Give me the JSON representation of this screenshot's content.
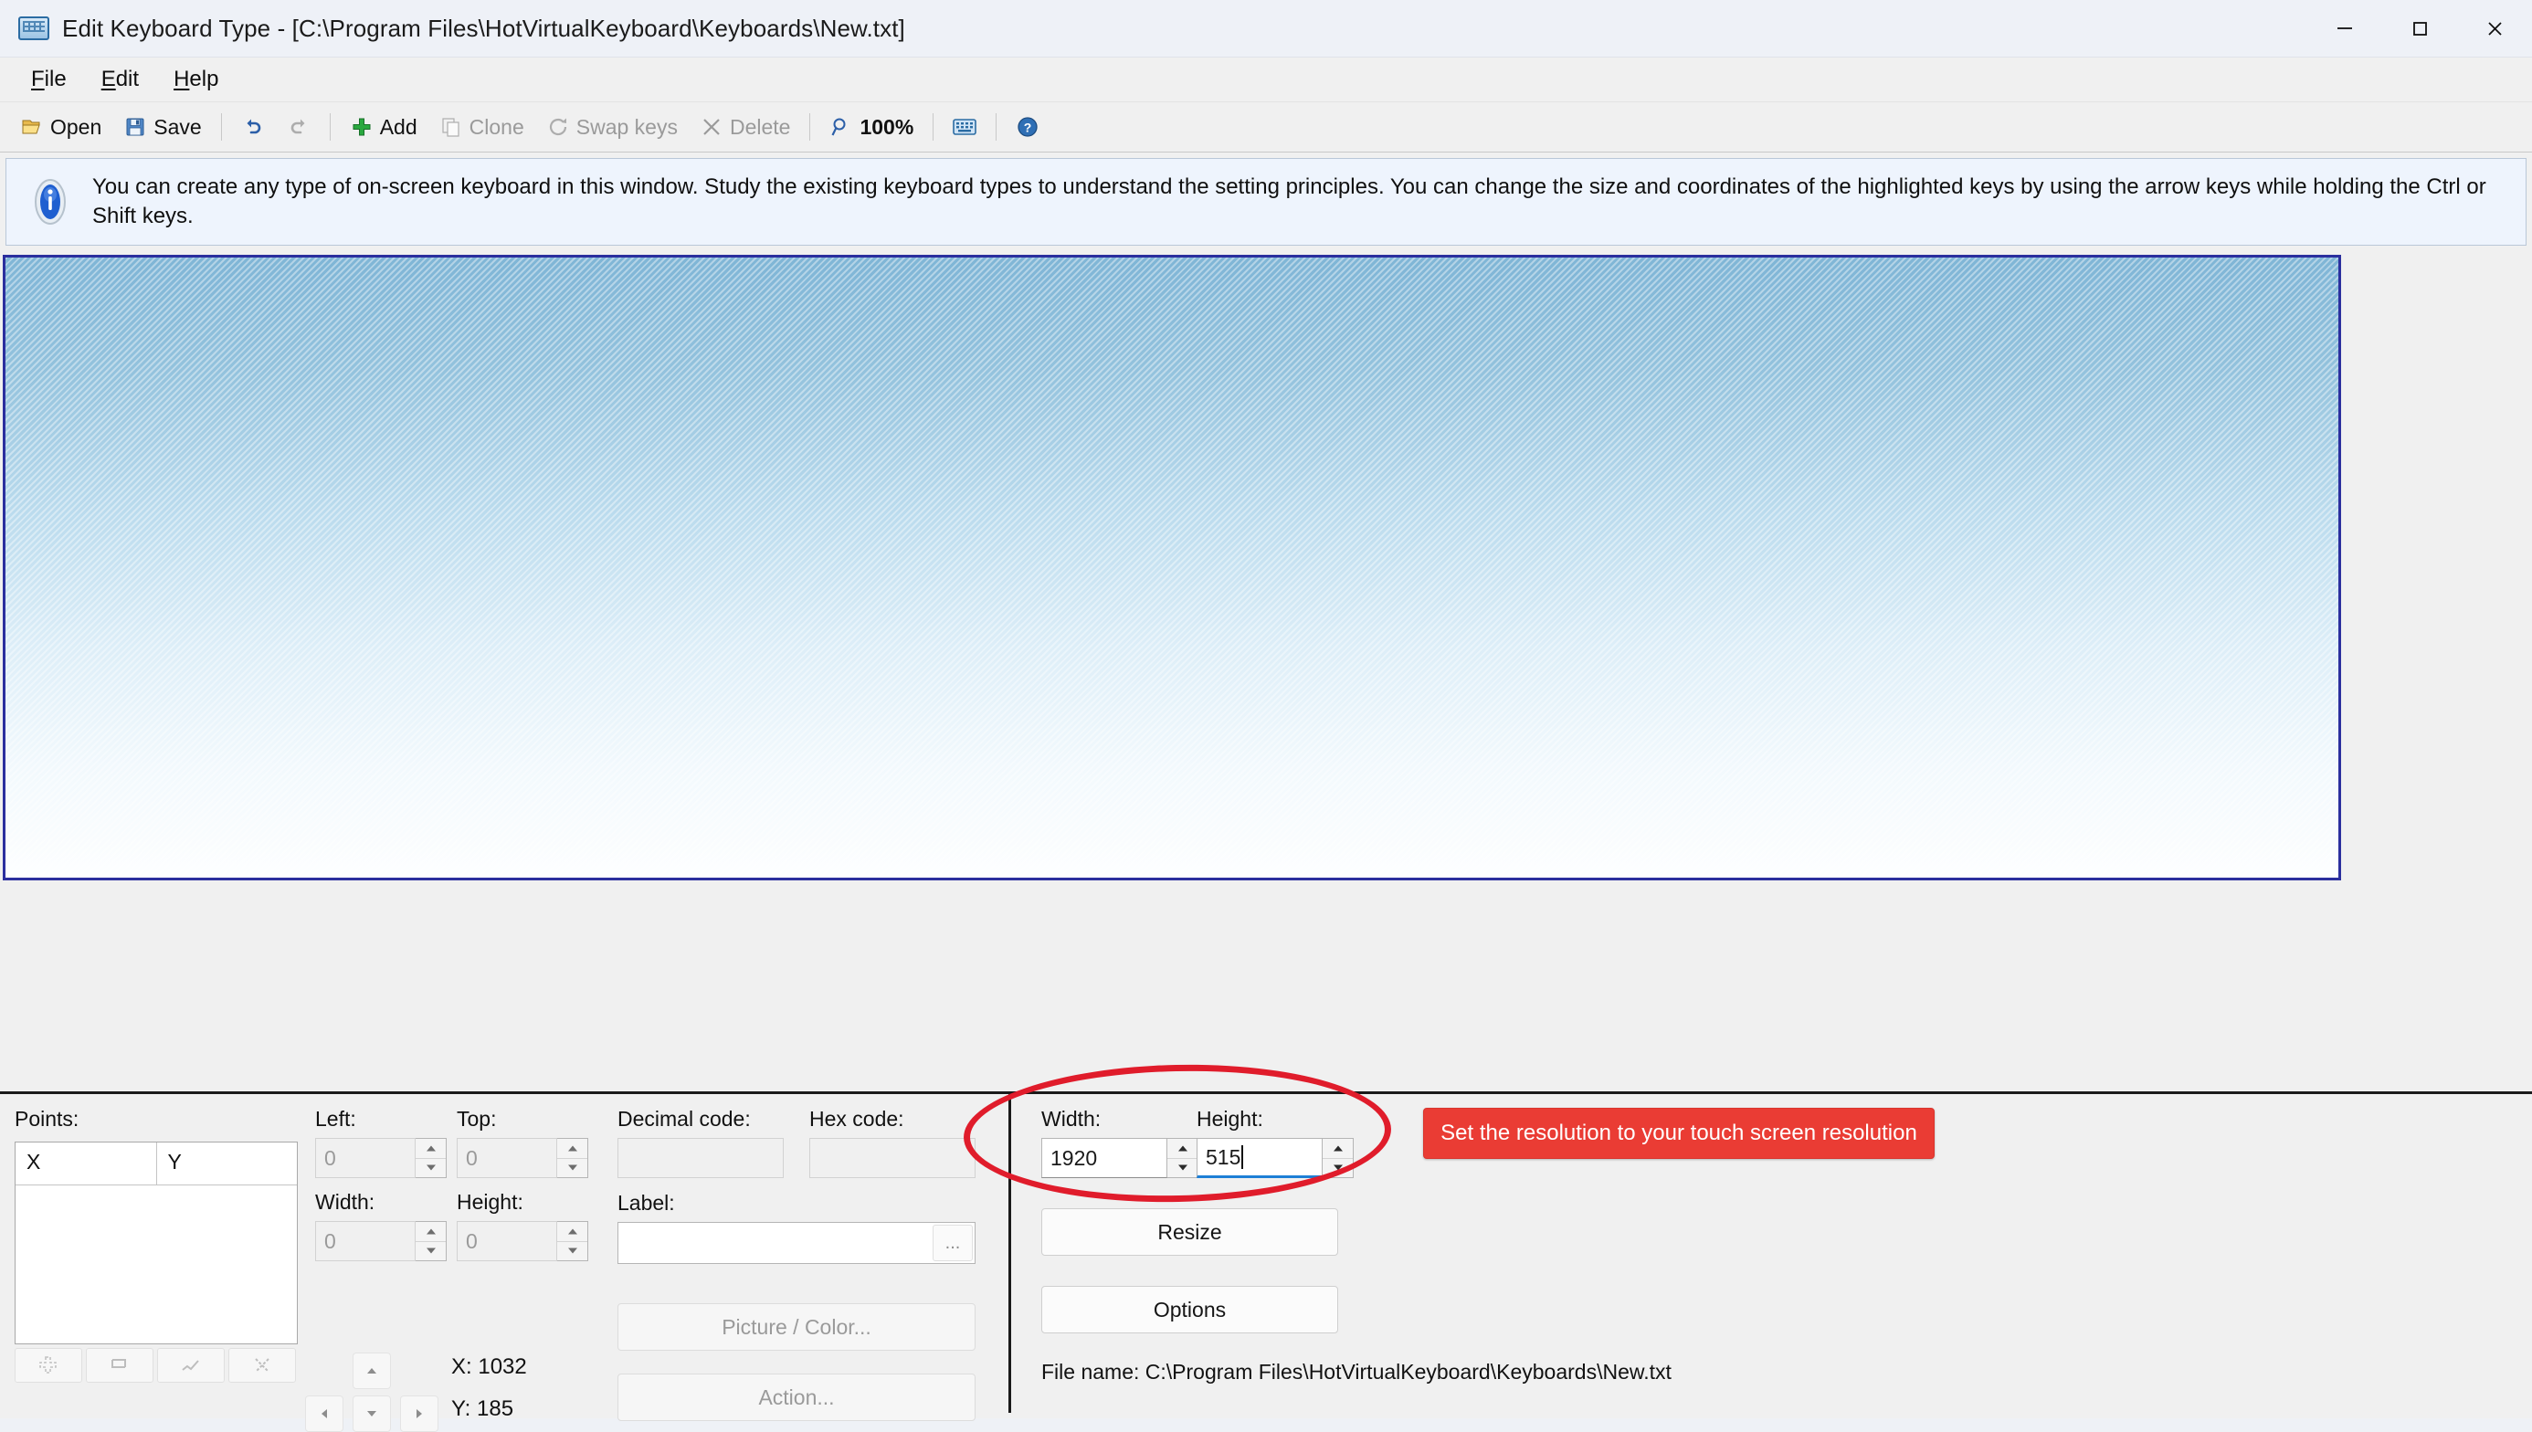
{
  "window": {
    "title": "Edit Keyboard Type - [C:\\Program Files\\HotVirtualKeyboard\\Keyboards\\New.txt]",
    "icon": "keyboard-icon",
    "controls": {
      "minimize": "minimize-icon",
      "maximize": "maximize-icon",
      "close": "close-icon"
    }
  },
  "menu": {
    "items": [
      {
        "label": "File",
        "mnemonic": "F"
      },
      {
        "label": "Edit",
        "mnemonic": "E"
      },
      {
        "label": "Help",
        "mnemonic": "H"
      }
    ]
  },
  "toolbar": {
    "items": [
      {
        "label": "Open",
        "icon": "open-folder-icon",
        "enabled": true
      },
      {
        "label": "Save",
        "icon": "save-disk-icon",
        "enabled": true
      },
      {
        "label": "",
        "icon": "undo-icon",
        "enabled": true
      },
      {
        "label": "",
        "icon": "redo-icon",
        "enabled": false
      },
      {
        "label": "Add",
        "icon": "plus-icon",
        "enabled": true
      },
      {
        "label": "Clone",
        "icon": "copy-icon",
        "enabled": false
      },
      {
        "label": "Swap keys",
        "icon": "swap-icon",
        "enabled": false
      },
      {
        "label": "Delete",
        "icon": "x-icon",
        "enabled": false
      },
      {
        "label": "100%",
        "icon": "zoom-icon",
        "enabled": true
      },
      {
        "label": "",
        "icon": "keyboard-icon",
        "enabled": true
      },
      {
        "label": "",
        "icon": "help-icon",
        "enabled": true
      }
    ]
  },
  "info": {
    "icon": "info-icon",
    "text": "You can create any type of on-screen keyboard in this window. Study the existing keyboard types to understand the setting principles. You can change the size and coordinates of the highlighted keys by using the arrow keys while holding the Ctrl or Shift keys."
  },
  "canvas": {
    "name": "keyboard-design-canvas",
    "gradient_top": "#7fb5d6",
    "gradient_bottom": "#fdfeff",
    "border_color": "#2b2f9e"
  },
  "panel": {
    "points": {
      "label": "Points:",
      "columns": [
        "X",
        "Y"
      ],
      "rows": [],
      "buttons": [
        "add-point-icon",
        "rect-point-icon",
        "line-point-icon",
        "delete-point-icon"
      ]
    },
    "geometry": {
      "left": {
        "label": "Left:",
        "value": "0",
        "enabled": false
      },
      "top": {
        "label": "Top:",
        "value": "0",
        "enabled": false
      },
      "width": {
        "label": "Width:",
        "value": "0",
        "enabled": false
      },
      "height": {
        "label": "Height:",
        "value": "0",
        "enabled": false
      }
    },
    "nudge": {
      "up": "arrow-up-icon",
      "down": "arrow-down-icon",
      "left": "arrow-left-icon",
      "right": "arrow-right-icon"
    },
    "cursor": {
      "x_label": "X: 1032",
      "y_label": "Y: 185"
    },
    "codes": {
      "decimal": {
        "label": "Decimal code:",
        "value": "",
        "enabled": false
      },
      "hex": {
        "label": "Hex code:",
        "value": "",
        "enabled": false
      }
    },
    "key_label": {
      "label": "Label:",
      "value": "",
      "placeholder": "",
      "browse": "..."
    },
    "picture_button": {
      "label": "Picture / Color...",
      "enabled": false
    },
    "action_button": {
      "label": "Action...",
      "enabled": false
    },
    "resolution": {
      "width": {
        "label": "Width:",
        "value": "1920",
        "focused": false
      },
      "height": {
        "label": "Height:",
        "value": "515",
        "focused": true
      },
      "resize_button": "Resize",
      "options_button": "Options",
      "highlight_color": "#e01c2b",
      "highlight_shape": "red-ellipse-annotation"
    },
    "callout_button": {
      "label": "Set the resolution to your touch screen resolution",
      "color": "#ea3c34"
    },
    "file_name": "File name: C:\\Program Files\\HotVirtualKeyboard\\Keyboards\\New.txt"
  }
}
